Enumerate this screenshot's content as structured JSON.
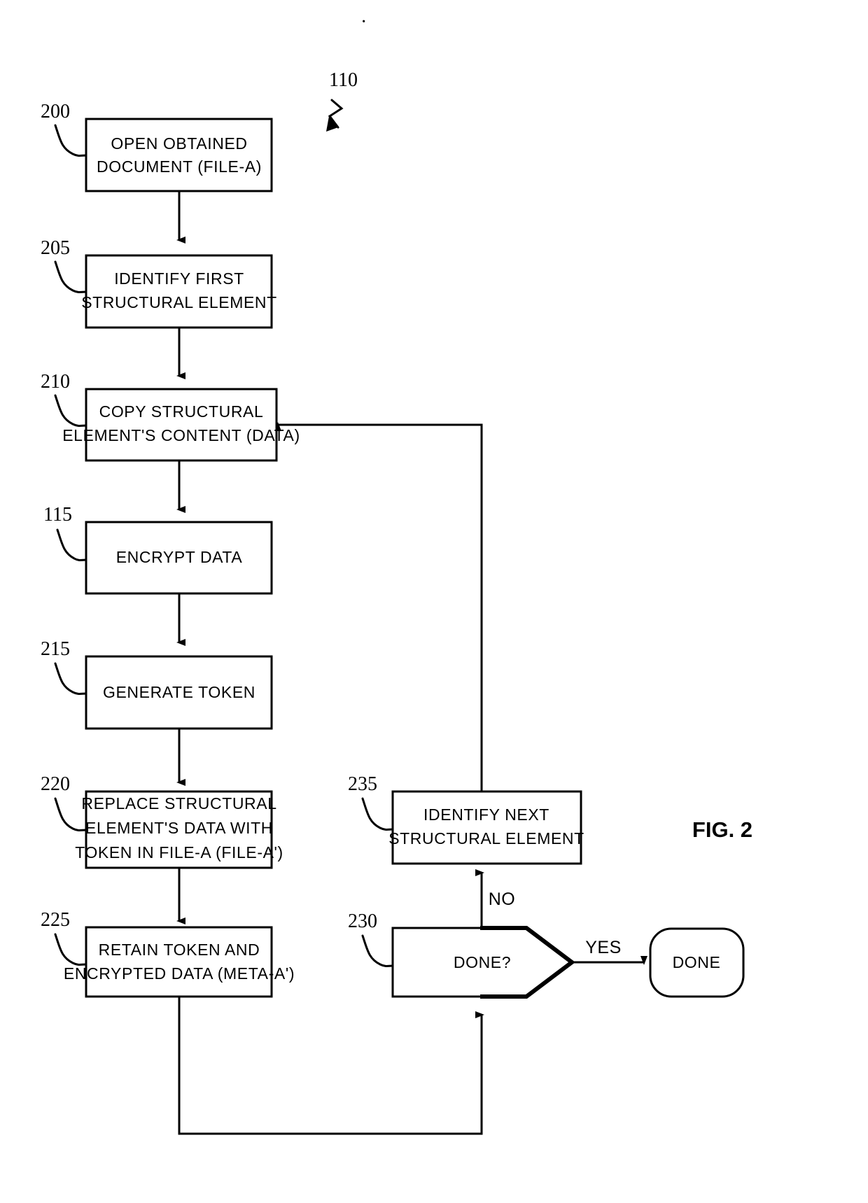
{
  "figure": {
    "caption": "FIG. 2",
    "process_ref": "110",
    "page_tick": "·"
  },
  "nodes": [
    {
      "id": "open-obtained-document",
      "ref": "200",
      "shape": "process",
      "lines": [
        "OPEN OBTAINED",
        "DOCUMENT (FILE-A)"
      ]
    },
    {
      "id": "identify-first-structural-element",
      "ref": "205",
      "shape": "process",
      "lines": [
        "IDENTIFY FIRST",
        "STRUCTURAL ELEMENT"
      ]
    },
    {
      "id": "copy-structural-element-content",
      "ref": "210",
      "shape": "process",
      "lines": [
        "COPY STRUCTURAL",
        "ELEMENT'S CONTENT (DATA)"
      ]
    },
    {
      "id": "encrypt-data",
      "ref": "115",
      "shape": "process",
      "lines": [
        "ENCRYPT DATA"
      ]
    },
    {
      "id": "generate-token",
      "ref": "215",
      "shape": "process",
      "lines": [
        "GENERATE TOKEN"
      ]
    },
    {
      "id": "replace-structural-element-data",
      "ref": "220",
      "shape": "process",
      "lines": [
        "REPLACE STRUCTURAL",
        "ELEMENT'S DATA WITH",
        "TOKEN IN FILE-A (FILE-A')"
      ]
    },
    {
      "id": "retain-token-and-encrypted-data",
      "ref": "225",
      "shape": "process",
      "lines": [
        "RETAIN TOKEN AND",
        "ENCRYPTED DATA (META-A')"
      ]
    },
    {
      "id": "done-decision",
      "ref": "230",
      "shape": "decision",
      "lines": [
        "DONE?"
      ]
    },
    {
      "id": "identify-next-structural-element",
      "ref": "235",
      "shape": "process",
      "lines": [
        "IDENTIFY NEXT",
        "STRUCTURAL ELEMENT"
      ]
    },
    {
      "id": "done-terminator",
      "ref": "",
      "shape": "terminator",
      "lines": [
        "DONE"
      ]
    }
  ],
  "edge_labels": {
    "no": "NO",
    "yes": "YES"
  },
  "colors": {
    "ink": "#000000",
    "paper": "#ffffff"
  }
}
